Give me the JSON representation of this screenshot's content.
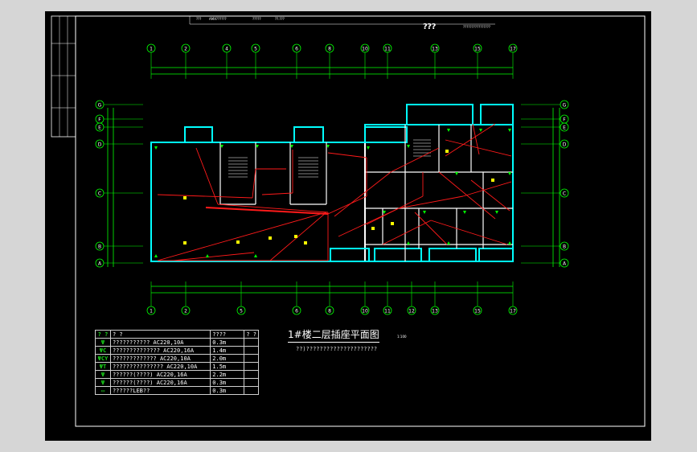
{
  "title": "1#楼二层插座平面图",
  "scale": "1:100",
  "note": "??)?????????????????????",
  "header": {
    "cell_a": "???",
    "cell_b": "AMX??????",
    "cell_c": "?????",
    "cell_d": "??.???",
    "logo": "???",
    "company": "????????????????"
  },
  "axes_top": [
    "1",
    "2",
    "4",
    "5",
    "6",
    "8",
    "10",
    "11",
    "13",
    "15",
    "17"
  ],
  "axes_bottom": [
    "1",
    "2",
    "5",
    "6",
    "8",
    "10",
    "11",
    "12",
    "13",
    "15",
    "17"
  ],
  "axes_left": [
    "G",
    "F",
    "E",
    "D",
    "C",
    "B",
    "A"
  ],
  "axes_right": [
    "G",
    "F",
    "E",
    "D",
    "C",
    "B",
    "A"
  ],
  "legend": {
    "header": [
      "? ?",
      "? ?",
      "????",
      "? ?"
    ],
    "rows": [
      {
        "symbol": "socket-icon",
        "glyph": "Ψ",
        "name": "???????????",
        "rating": "AC220,10A",
        "height": "0.3m",
        "note": ""
      },
      {
        "symbol": "socket-c-icon",
        "glyph": "ΨC",
        "name": "??????????????",
        "rating": "AC220,16A",
        "height": "1.4m",
        "note": ""
      },
      {
        "symbol": "socket-cy-icon",
        "glyph": "ΨCY",
        "name": "?????????????",
        "rating": "AC220,10A",
        "height": "2.0m",
        "note": ""
      },
      {
        "symbol": "socket-t-icon",
        "glyph": "ΨT",
        "name": "???????????????",
        "rating": "AC220,10A",
        "height": "1.5m",
        "note": ""
      },
      {
        "symbol": "socket-k-icon",
        "glyph": "Ψ",
        "name": "??????(????)",
        "rating": "AC220,16A",
        "height": "2.2m",
        "note": ""
      },
      {
        "symbol": "socket-k2-icon",
        "glyph": "Ψ",
        "name": "??????(????)",
        "rating": "AC220,16A",
        "height": "0.3m",
        "note": ""
      },
      {
        "symbol": "box-icon",
        "glyph": "▭",
        "name": "??????LEB??",
        "rating": "",
        "height": "0.3m",
        "note": ""
      }
    ]
  },
  "colors": {
    "background": "#000000",
    "wall": "#00ffff",
    "wiring": "#ff1a1a",
    "dimension": "#00ff00",
    "text": "#ffffff"
  }
}
